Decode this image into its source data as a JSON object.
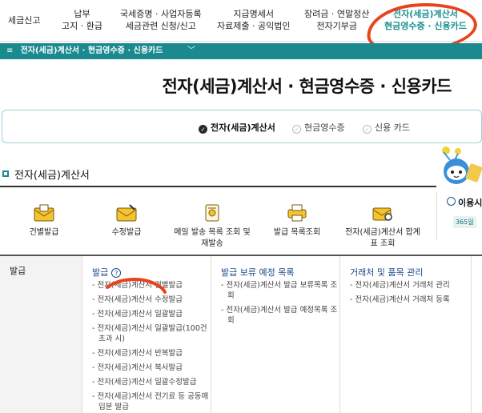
{
  "top_nav": {
    "items": [
      {
        "label": "세금신고"
      },
      {
        "line1": "납부",
        "line2": "고지 · 환급"
      },
      {
        "line1": "국세증명 · 사업자등록",
        "line2": "세금관련 신청/신고"
      },
      {
        "line1": "지급명세서",
        "line2": "자료제출 · 공익법인"
      },
      {
        "line1": "장려금 · 연말정산",
        "line2": "전자기부금"
      },
      {
        "line1": "전자(세금)계산서",
        "line2": "현금영수증 · 신용카드"
      }
    ]
  },
  "breadcrumb": {
    "menu_icon": "≡",
    "label": "전자(세금)계산서 · 현금영수증 · 신용카드",
    "chevron": "﹀"
  },
  "page_title": "전자(세금)계산서 · 현금영수증 · 신용카드",
  "tabs": [
    {
      "label": "전자(세금)계산서",
      "active": true
    },
    {
      "label": "현금영수증",
      "active": false
    },
    {
      "label": "신용 카드",
      "active": false
    }
  ],
  "section_title": "전자(세금)계산서",
  "quick_icons": [
    {
      "label": "건별발급",
      "icon": "envelope-icon"
    },
    {
      "label": "수정발급",
      "icon": "envelope-edit-icon"
    },
    {
      "label": "메일 발송 목록 조회 및 재발송",
      "icon": "scroll-icon"
    },
    {
      "label": "발급 목록조회",
      "icon": "printer-icon"
    },
    {
      "label": "전자(세금)계산서 합계표 조회",
      "icon": "envelope-search-icon"
    }
  ],
  "right_box": {
    "title": "이용시",
    "badge": "365일"
  },
  "menu": {
    "side_header": "발급",
    "columns": [
      {
        "header": "발급",
        "help": "?",
        "items": [
          "전자(세금)계산서 건별발급",
          "전자(세금)계산서 수정발급",
          "전자(세금)계산서 일괄발급",
          "전자(세금)계산서 일괄발급(100건 초과 시)",
          "전자(세금)계산서 반복발급",
          "전자(세금)계산서 복사발급",
          "전자(세금)계산서 일괄수정발급",
          "전자(세금)계산서 전기료 등 공동매입분 발급"
        ]
      },
      {
        "header": "발급 보류 예정 목록",
        "items": [
          "전자(세금)계산서 발급 보류목록 조회",
          "전자(세금)계산서 발급 예정목록 조회"
        ]
      },
      {
        "header": "거래처 및 품목 관리",
        "items": [
          "전자(세금)계산서 거래처 관리",
          "전자(세금)계산서 거래처 등록"
        ]
      }
    ]
  },
  "colors": {
    "accent": "#1b8a8f",
    "annotation": "#e8431c",
    "link": "#1a4a8a"
  }
}
